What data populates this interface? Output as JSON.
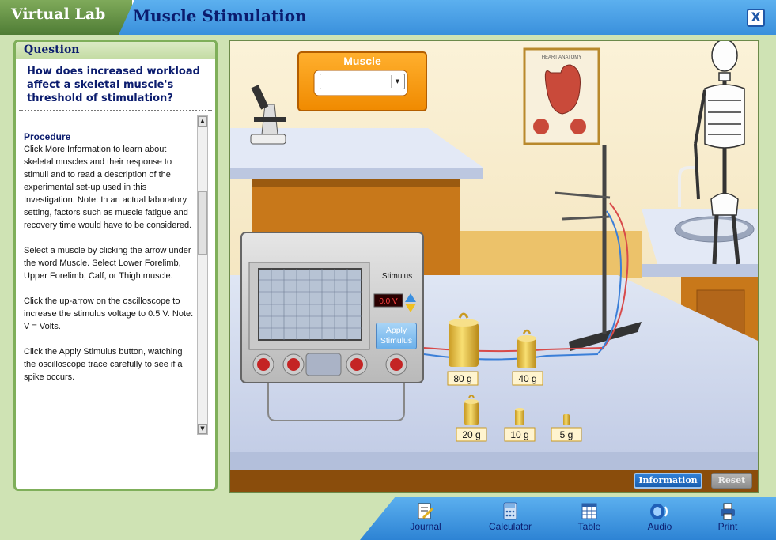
{
  "header": {
    "brand": "Virtual Lab",
    "title": "Muscle Stimulation",
    "close_label": "X"
  },
  "question": {
    "heading": "Question",
    "text": "How does increased workload affect a skeletal muscle's threshold of stimulation?"
  },
  "procedure": {
    "heading": "Procedure",
    "paragraphs": [
      "Click More Information to learn about skeletal muscles and their response to stimuli and to read a description of the experimental set-up used in this Investigation. Note: In an actual laboratory setting, factors such as muscle fatigue and recovery time would have to be considered.",
      "Select a muscle by clicking the arrow under the word Muscle. Select Lower Forelimb, Upper Forelimb, Calf, or Thigh muscle.",
      "Click the up-arrow on the oscilloscope to increase the stimulus voltage to 0.5 V. Note: V = Volts.",
      "Click the Apply Stimulus button, watching the oscilloscope trace carefully to see if a spike occurs."
    ]
  },
  "muscle_selector": {
    "label": "Muscle",
    "selected": ""
  },
  "oscilloscope": {
    "stimulus_label": "Stimulus",
    "voltage": "0.0 V",
    "apply_line1": "Apply",
    "apply_line2": "Stimulus"
  },
  "weights": [
    "80 g",
    "40 g",
    "20 g",
    "10 g",
    "5 g"
  ],
  "poster_caption": "HEART ANATOMY",
  "scene_buttons": {
    "information": "Information",
    "reset": "Reset"
  },
  "toolbar": {
    "journal": "Journal",
    "calculator": "Calculator",
    "table": "Table",
    "audio": "Audio",
    "print": "Print"
  },
  "colors": {
    "header_blue": "#3a90dc",
    "title_navy": "#0b1c6e",
    "panel_green": "#7faf5a",
    "voltage_red": "#ff4040"
  }
}
